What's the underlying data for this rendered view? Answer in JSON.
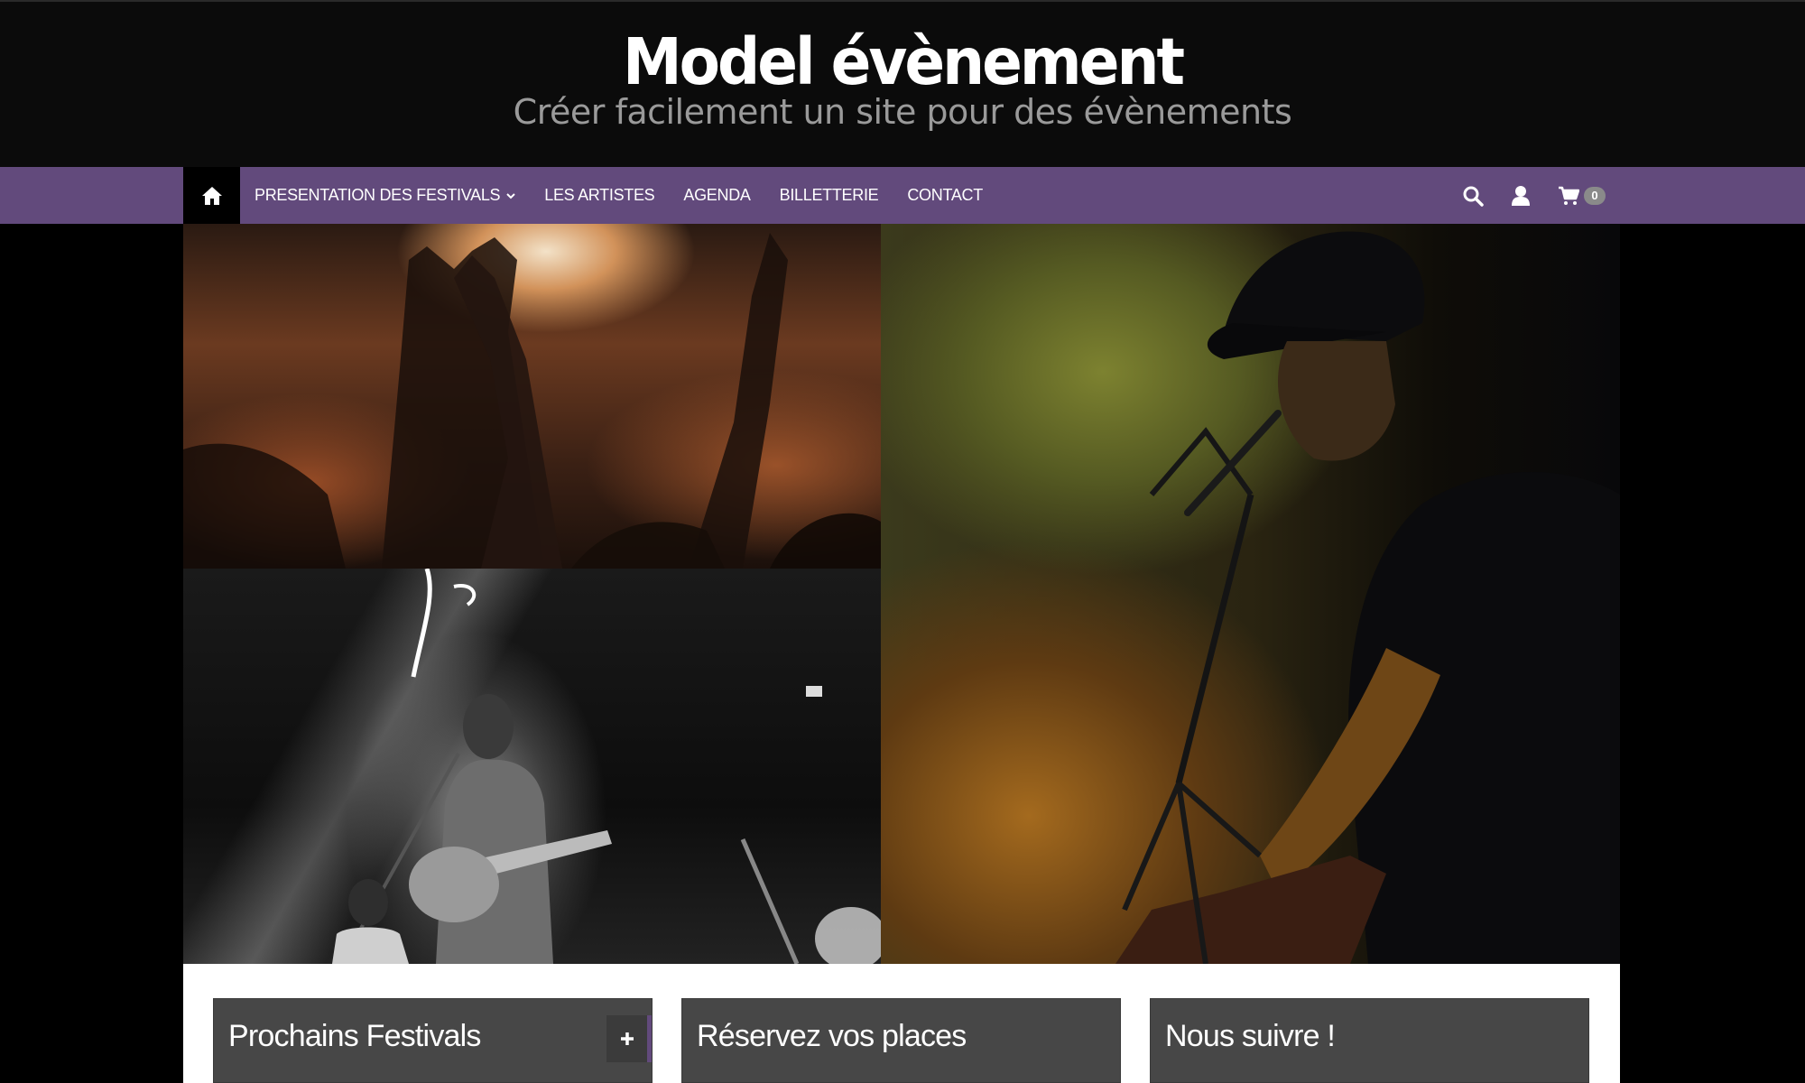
{
  "header": {
    "title": "Model évènement",
    "tagline": "Créer facilement un site pour des évènements"
  },
  "nav": {
    "home_icon": "home-icon",
    "items": [
      {
        "label": "PRESENTATION DES FESTIVALS",
        "has_dropdown": true
      },
      {
        "label": "LES ARTISTES"
      },
      {
        "label": "AGENDA"
      },
      {
        "label": "BILLETTERIE"
      },
      {
        "label": "CONTACT"
      }
    ],
    "tools": {
      "search_icon": "search-icon",
      "user_icon": "user-icon",
      "cart_icon": "cart-icon",
      "cart_count": "0"
    },
    "color": "#624a7c"
  },
  "hero": {
    "images": [
      "concert-crowd-photo",
      "guitarist-bw-photo",
      "singer-keyboard-photo"
    ]
  },
  "widgets": [
    {
      "title": "Prochains Festivals",
      "has_toggle": true
    },
    {
      "title": "Réservez vos places"
    },
    {
      "title": "Nous suivre !"
    }
  ]
}
